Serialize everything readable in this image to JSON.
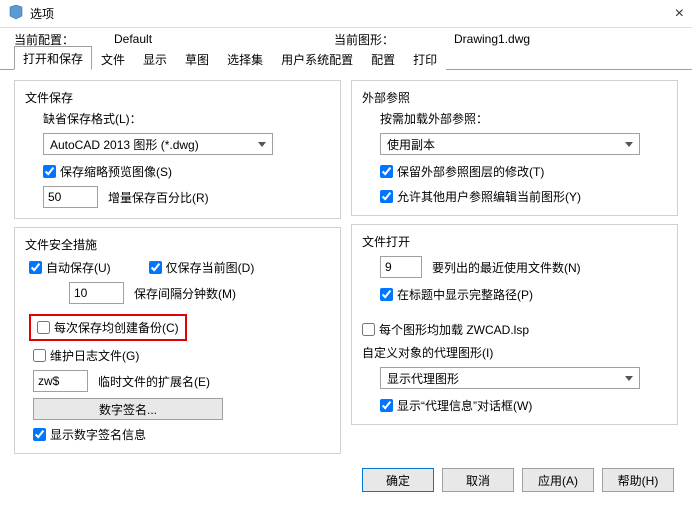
{
  "window": {
    "title": "选项"
  },
  "info": {
    "current_profile_label": "当前配置：",
    "current_profile_value": "Default",
    "current_drawing_label": "当前图形：",
    "current_drawing_value": "Drawing1.dwg"
  },
  "tabs": {
    "open_save": "打开和保存",
    "file": "文件",
    "display": "显示",
    "draft": "草图",
    "selection": "选择集",
    "user_prefs": "用户系统配置",
    "profile": "配置",
    "print": "打印"
  },
  "left": {
    "file_save": {
      "title": "文件保存",
      "default_fmt_label": "缺省保存格式(L)：",
      "default_fmt_value": "AutoCAD 2013 图形 (*.dwg)",
      "thumbnail_label": "保存缩略预览图像(S)",
      "incr_value": "50",
      "incr_label": "增量保存百分比(R)"
    },
    "file_safety": {
      "title": "文件安全措施",
      "autosave_label": "自动保存(U)",
      "only_current_label": "仅保存当前图(D)",
      "interval_value": "10",
      "interval_label": "保存间隔分钟数(M)",
      "backup_each_label": "每次保存均创建备份(C)",
      "maint_log_label": "维护日志文件(G)",
      "temp_ext_value": "zw$",
      "temp_ext_label": "临时文件的扩展名(E)",
      "dig_sig_btn": "数字签名...",
      "show_dig_sig_label": "显示数字签名信息"
    }
  },
  "right": {
    "xref": {
      "title": "外部参照",
      "demand_label": "按需加载外部参照：",
      "demand_value": "使用副本",
      "keep_layers_label": "保留外部参照图层的修改(T)",
      "allow_edit_label": "允许其他用户参照编辑当前图形(Y)"
    },
    "file_open": {
      "title": "文件打开",
      "recent_value": "9",
      "recent_label": "要列出的最近使用文件数(N)",
      "fullpath_label": "在标题中显示完整路径(P)",
      "each_load_label": "每个图形均加载 ZWCAD.lsp"
    },
    "proxy": {
      "title": "自定义对象的代理图形(I)",
      "proxy_value": "显示代理图形",
      "show_dialog_label": "显示“代理信息”对话框(W)"
    }
  },
  "footer": {
    "ok": "确定",
    "cancel": "取消",
    "apply": "应用(A)",
    "help": "帮助(H)"
  }
}
